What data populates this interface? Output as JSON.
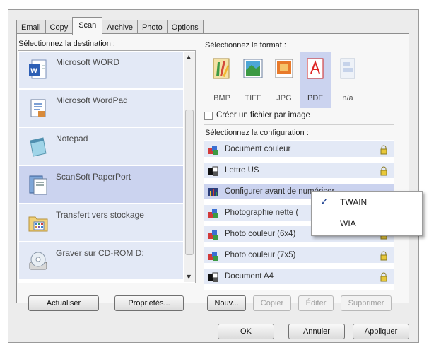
{
  "tabs": [
    "Email",
    "Copy",
    "Scan",
    "Archive",
    "Photo",
    "Options"
  ],
  "active_tab": "Scan",
  "destination": {
    "label": "Sélectionnez la destination :",
    "items": [
      {
        "label": "Microsoft WORD",
        "icon": "word-icon",
        "selected": false
      },
      {
        "label": "Microsoft WordPad",
        "icon": "wordpad-icon",
        "selected": false
      },
      {
        "label": "Notepad",
        "icon": "notepad-icon",
        "selected": false
      },
      {
        "label": "ScanSoft PaperPort",
        "icon": "paperport-icon",
        "selected": true
      },
      {
        "label": "Transfert vers stockage",
        "icon": "storage-folder-icon",
        "selected": false
      },
      {
        "label": "Graver sur CD-ROM  D:",
        "icon": "cd-burn-icon",
        "selected": false
      }
    ],
    "buttons": {
      "refresh": "Actualiser",
      "properties": "Propriétés..."
    }
  },
  "format": {
    "label": "Sélectionnez le format :",
    "items": [
      {
        "label": "BMP",
        "icon": "bmp-icon",
        "selected": false
      },
      {
        "label": "TIFF",
        "icon": "tiff-icon",
        "selected": false
      },
      {
        "label": "JPG",
        "icon": "jpg-icon",
        "selected": false
      },
      {
        "label": "PDF",
        "icon": "pdf-icon",
        "selected": true
      },
      {
        "label": "n/a",
        "icon": "na-icon",
        "selected": false
      }
    ],
    "one_file_per_image": "Créer un fichier par image"
  },
  "configuration": {
    "label": "Sélectionnez la configuration :",
    "items": [
      {
        "label": "Document couleur",
        "icon": "color-blocks-icon",
        "selected": false
      },
      {
        "label": "Lettre US",
        "icon": "bw-blocks-icon",
        "selected": false
      },
      {
        "label": "Configurer avant de numériser",
        "icon": "configure-icon",
        "selected": true
      },
      {
        "label": "Photographie nette (",
        "icon": "color-blocks-icon",
        "selected": false
      },
      {
        "label": "Photo couleur (6x4)",
        "icon": "color-blocks-icon",
        "selected": false
      },
      {
        "label": "Photo couleur (7x5)",
        "icon": "color-blocks-icon",
        "selected": false
      },
      {
        "label": "Document A4",
        "icon": "bw-blocks-icon",
        "selected": false
      }
    ],
    "buttons": {
      "new": "Nouv...",
      "copy": "Copier",
      "edit": "Éditer",
      "delete": "Supprimer"
    }
  },
  "context_menu": {
    "items": [
      {
        "label": "TWAIN",
        "checked": true
      },
      {
        "label": "WIA",
        "checked": false
      }
    ]
  },
  "footer": {
    "ok": "OK",
    "cancel": "Annuler",
    "apply": "Appliquer"
  },
  "colors": {
    "selection": "#cbd3ef",
    "item_bg": "#e3e9f6",
    "panel": "#f7f7f7",
    "dialog": "#ececec"
  }
}
